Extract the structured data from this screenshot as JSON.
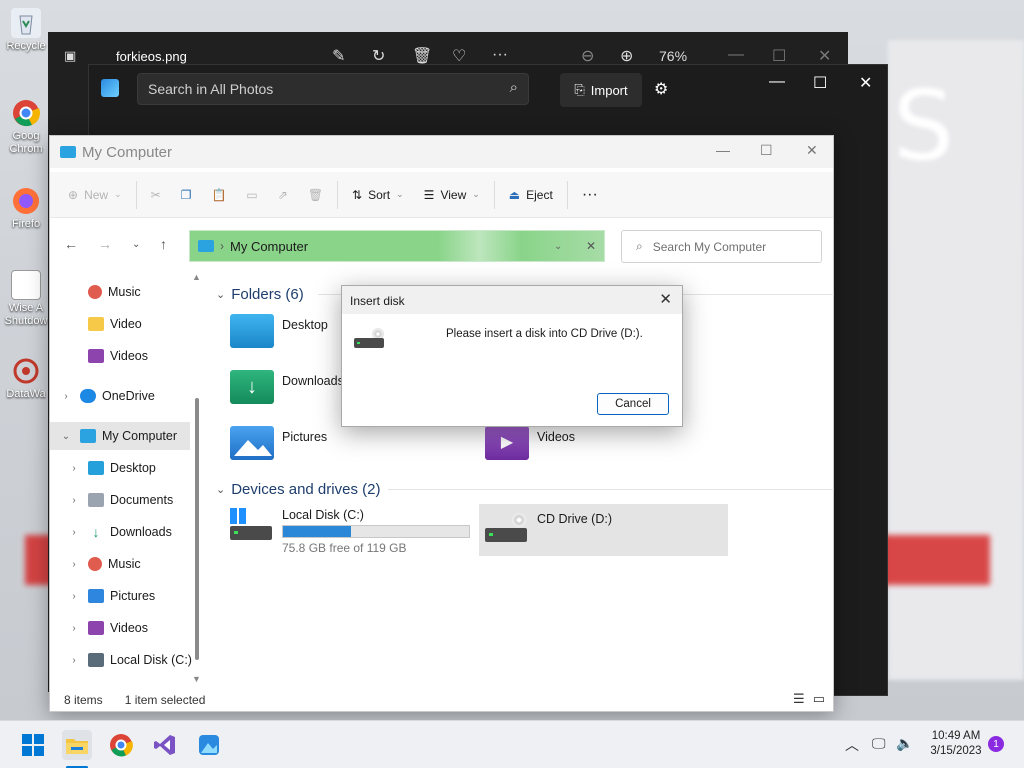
{
  "desktop": {
    "icons": [
      {
        "label": "Recycle",
        "icon": "recycle-bin-icon"
      },
      {
        "label": "Goog Chrom",
        "icon": "chrome-icon"
      },
      {
        "label": "Firefo",
        "icon": "firefox-icon"
      },
      {
        "label": "Wise A Shutdow",
        "icon": "wise-shutdown-icon"
      },
      {
        "label": "DataWa",
        "icon": "datawave-icon"
      }
    ]
  },
  "photos_viewer": {
    "filename": "forkieos.png",
    "zoom": "76%"
  },
  "photos_app": {
    "search_placeholder": "Search in All Photos",
    "import_label": "Import"
  },
  "explorer": {
    "title": "My Computer",
    "toolbar": {
      "new": "New",
      "sort": "Sort",
      "view": "View",
      "eject": "Eject"
    },
    "address": "My Computer",
    "search_placeholder": "Search My Computer",
    "nav": [
      {
        "label": "Music"
      },
      {
        "label": "Video"
      },
      {
        "label": "Videos"
      },
      {
        "label": "OneDrive"
      },
      {
        "label": "My Computer"
      },
      {
        "label": "Desktop"
      },
      {
        "label": "Documents"
      },
      {
        "label": "Downloads"
      },
      {
        "label": "Music"
      },
      {
        "label": "Pictures"
      },
      {
        "label": "Videos"
      },
      {
        "label": "Local Disk (C:)"
      }
    ],
    "folders_header": "Folders (6)",
    "folders": [
      {
        "label": "Desktop"
      },
      {
        "label": "Downloads"
      },
      {
        "label": "Pictures"
      },
      {
        "label": "Videos"
      }
    ],
    "drives_header": "Devices and drives (2)",
    "drives": [
      {
        "label": "Local Disk (C:)",
        "free": "75.8 GB free of 119 GB",
        "used_fraction": 0.363
      },
      {
        "label": "CD Drive (D:)"
      }
    ],
    "status": {
      "items": "8 items",
      "selected": "1 item selected"
    }
  },
  "dialog": {
    "title": "Insert disk",
    "message": "Please insert a disk into CD Drive (D:).",
    "cancel": "Cancel"
  },
  "taskbar": {
    "time": "10:49 AM",
    "date": "3/15/2023",
    "notification_count": "1"
  },
  "colors": {
    "accent": "#0a64c2",
    "address_bar": "#8ad48a",
    "drive_bar": "#2b88d9"
  }
}
